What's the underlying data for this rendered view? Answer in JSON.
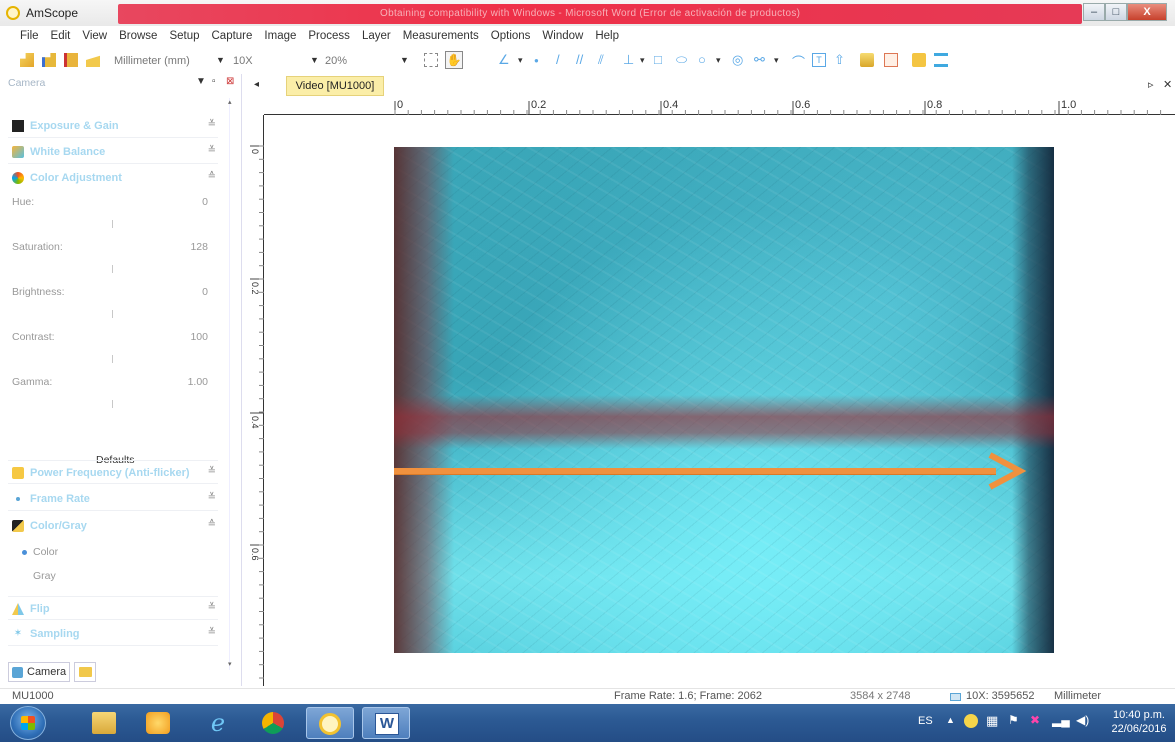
{
  "window": {
    "app_title": "AmScope",
    "title_text": "Obtaining compatibility with Windows - Microsoft Word (Error de activación de productos)",
    "controls": {
      "minimize": "–",
      "maximize": "□",
      "close": "X"
    }
  },
  "menu": [
    "File",
    "Edit",
    "View",
    "Browse",
    "Setup",
    "Capture",
    "Image",
    "Process",
    "Layer",
    "Measurements",
    "Options",
    "Window",
    "Help"
  ],
  "toolbar": {
    "unit": "Millimeter (mm)",
    "magnification": "10X",
    "zoom": "20%"
  },
  "left_panel": {
    "header": "Camera",
    "sections": {
      "exposure": "Exposure & Gain",
      "white_balance": "White Balance",
      "color_adjustment": "Color Adjustment",
      "power_frequency": "Power Frequency (Anti-flicker)",
      "frame_rate": "Frame Rate",
      "color_gray": "Color/Gray",
      "flip": "Flip",
      "sampling": "Sampling"
    },
    "params": [
      {
        "label": "Hue:",
        "value": "0"
      },
      {
        "label": "Saturation:",
        "value": "128"
      },
      {
        "label": "Brightness:",
        "value": "0"
      },
      {
        "label": "Contrast:",
        "value": "100"
      },
      {
        "label": "Gamma:",
        "value": "1.00"
      }
    ],
    "defaults_button": "Defaults",
    "color_modes": {
      "color": "Color",
      "gray": "Gray"
    },
    "bottom_tab": "Camera"
  },
  "document": {
    "tab_label": "Video [MU1000]",
    "ruler_top": [
      "0",
      "0.2",
      "0.4",
      "0.6",
      "0.8",
      "1.0"
    ],
    "ruler_left": [
      "0",
      "0.2",
      "0.4",
      "0.6"
    ]
  },
  "status": {
    "camera": "MU1000",
    "frame_info": "Frame Rate: 1.6; Frame: 2062",
    "resolution": "3584 x 2748",
    "magnification": "10X: 3595652",
    "unit": "Millimeter"
  },
  "taskbar": {
    "language": "ES",
    "time": "10:40 p.m.",
    "date": "22/06/2016"
  },
  "colors": {
    "title_red": "#ee3048",
    "arrow_orange": "#f0913e",
    "section_title": "#a7d8f0",
    "doc_tab": "#fbeea8",
    "taskbar": "#2c5a94"
  }
}
